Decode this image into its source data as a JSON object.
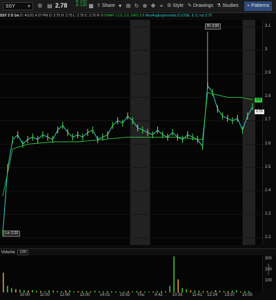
{
  "toolbar": {
    "symbol": "SSY",
    "last_price": "2.78",
    "bid_label": "B: 2.62",
    "ask_label": "A: 2.82",
    "share": "Share",
    "style": "Style",
    "drawings": "Drawings",
    "studies": "Studies",
    "patterns": "Patterns"
  },
  "infobar": {
    "symbol_period": "SSY 2 D 1m",
    "date": "D: 4/1/21 4:37 PM",
    "open": "O: 2.75",
    "high": "H: 2.75",
    "low": "L: 2.75",
    "close": "C: 2.75",
    "range": "R: 0",
    "vwap": "VWAP (-2.0, 2.0, DAY) 2.6",
    "ema": "MovAvgExponential (CLOSE, 9, 0, no)",
    "ema_value": "2.75"
  },
  "chart_data": {
    "type": "line",
    "x_ticks": [
      "10:00",
      "11:00",
      "12:00",
      "13:00",
      "14:01",
      "15:02",
      "Thu",
      "9:42",
      "10:33",
      "11:41",
      "12:24",
      "13:37",
      "15:05"
    ],
    "y_ticks": [
      "3.1",
      "3",
      "2.9",
      "2.8",
      "2.7",
      "2.6",
      "2.5",
      "2.4",
      "2.3",
      "2.2"
    ],
    "ylim": [
      2.17,
      3.13
    ],
    "hi_label": "Hi: 3.09",
    "lo_label": "Lo: 2.22",
    "vwap_tag": "2.8",
    "price_tag": "2.75",
    "series": [
      {
        "name": "MovAvgExponential",
        "color": "#2fd0d0",
        "x": [
          0,
          2,
          4,
          6,
          8,
          10,
          12,
          14,
          16,
          18,
          20,
          22,
          24,
          26,
          28,
          30,
          32,
          34,
          36,
          38,
          40,
          42,
          44,
          46,
          48,
          50,
          52,
          54,
          56,
          58,
          60,
          62,
          64,
          66,
          68,
          70,
          72,
          74,
          76,
          78,
          80,
          82,
          84,
          86,
          88,
          90,
          92,
          94,
          96,
          98,
          100
        ],
        "values": [
          2.22,
          2.5,
          2.62,
          2.64,
          2.6,
          2.62,
          2.63,
          2.62,
          2.64,
          2.63,
          2.62,
          2.66,
          2.68,
          2.65,
          2.63,
          2.64,
          2.63,
          2.65,
          2.66,
          2.62,
          2.63,
          2.64,
          2.68,
          2.7,
          2.69,
          2.72,
          2.7,
          2.67,
          2.66,
          2.65,
          2.64,
          2.66,
          2.64,
          2.63,
          2.65,
          2.63,
          2.62,
          2.64,
          2.63,
          2.62,
          2.59,
          2.85,
          2.82,
          2.75,
          2.72,
          2.71,
          2.7,
          2.71,
          2.66,
          2.72,
          2.76
        ]
      },
      {
        "name": "VWAP",
        "color": "#2ecc40",
        "x": [
          0,
          4,
          10,
          20,
          30,
          40,
          50,
          60,
          70,
          78,
          80,
          82,
          86,
          90,
          95,
          100
        ],
        "values": [
          2.38,
          2.58,
          2.6,
          2.61,
          2.61,
          2.62,
          2.63,
          2.63,
          2.63,
          2.62,
          2.62,
          2.82,
          2.81,
          2.8,
          2.8,
          2.79
        ]
      }
    ],
    "volume": {
      "y_ticks": [
        "300",
        "200",
        "100"
      ],
      "ylim": [
        0,
        340
      ],
      "values": [
        180,
        60,
        40,
        30,
        25,
        20,
        18,
        22,
        15,
        14,
        12,
        20,
        16,
        14,
        12,
        18,
        20,
        10,
        12,
        14,
        12,
        10,
        16,
        12,
        10,
        14,
        12,
        10,
        8,
        10,
        12,
        10,
        14,
        12,
        10,
        8,
        10,
        12,
        14,
        10,
        60,
        330,
        120,
        40,
        30,
        20,
        18,
        16,
        12,
        14,
        10,
        20,
        16,
        14,
        12,
        18,
        22,
        10,
        12,
        14
      ]
    }
  },
  "volume_header": {
    "label": "Volume",
    "value": "100"
  },
  "side_label": "Drawings"
}
